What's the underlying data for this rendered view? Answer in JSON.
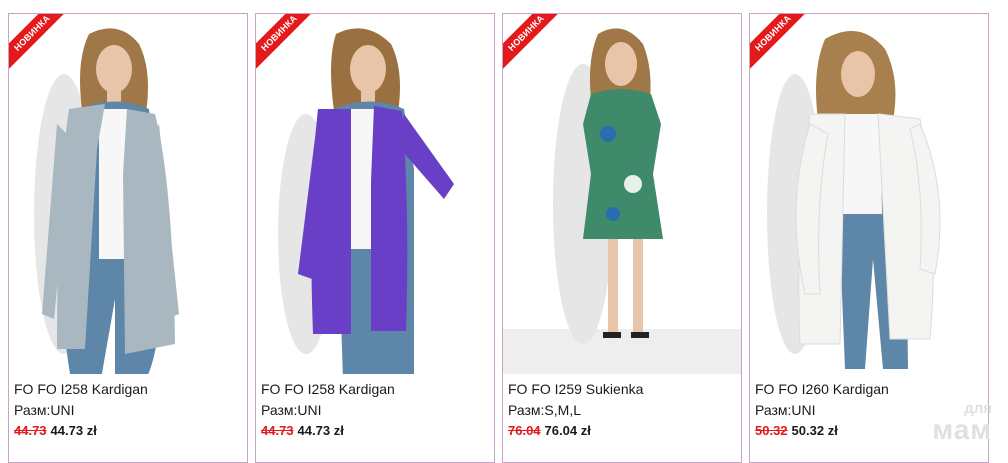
{
  "products": [
    {
      "badge": "НОВИНКА",
      "title": "FO FO I258 Kardigan",
      "size": "Разм:UNI",
      "old_price": "44.73",
      "new_price": "44.73 zł",
      "image": "model-grey-cardigan",
      "color": "#a9b8c0"
    },
    {
      "badge": "НОВИНКА",
      "title": "FO FO I258 Kardigan",
      "size": "Разм:UNI",
      "old_price": "44.73",
      "new_price": "44.73 zł",
      "image": "model-purple-cardigan",
      "color": "#6a3fc8"
    },
    {
      "badge": "НОВИНКА",
      "title": "FO FO I259 Sukienka",
      "size": "Разм:S,M,L",
      "old_price": "76.04",
      "new_price": "76.04 zł",
      "image": "model-green-print-dress",
      "color": "#3f8a6a"
    },
    {
      "badge": "НОВИНКА",
      "title": "FO FO I260 Kardigan",
      "size": "Разм:UNI",
      "old_price": "50.32",
      "new_price": "50.32 zł",
      "image": "model-white-cardigan",
      "color": "#f4f4f2"
    }
  ],
  "watermark": {
    "line1": "для",
    "line2": "мам"
  }
}
